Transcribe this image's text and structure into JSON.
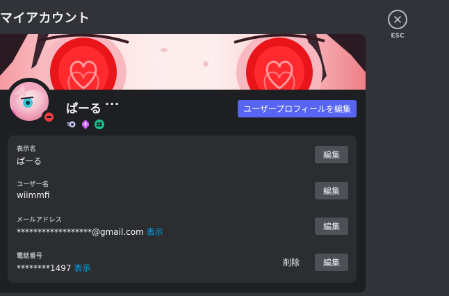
{
  "page_title": "マイアカウント",
  "esc_label": "ESC",
  "profile": {
    "display_name": "ぱーる",
    "more": "···",
    "edit_profile_label": "ユーザープロフィールを編集",
    "badges": [
      "nitro-badge-icon",
      "boost-badge-icon",
      "hypesquad-badge-icon"
    ]
  },
  "fields": {
    "display_name": {
      "label": "表示名",
      "value": "ぱーる",
      "edit": "編集"
    },
    "username": {
      "label": "ユーザー名",
      "value": "wiimmfi",
      "edit": "編集"
    },
    "email": {
      "label": "メールアドレス",
      "value": "******************@gmail.com",
      "reveal": "表示",
      "edit": "編集"
    },
    "phone": {
      "label": "電話番号",
      "value": "********1497",
      "reveal": "表示",
      "delete": "削除",
      "edit": "編集"
    }
  },
  "colors": {
    "accent": "#5865f2",
    "link": "#00a8fc",
    "status_dnd": "#f23f43"
  }
}
